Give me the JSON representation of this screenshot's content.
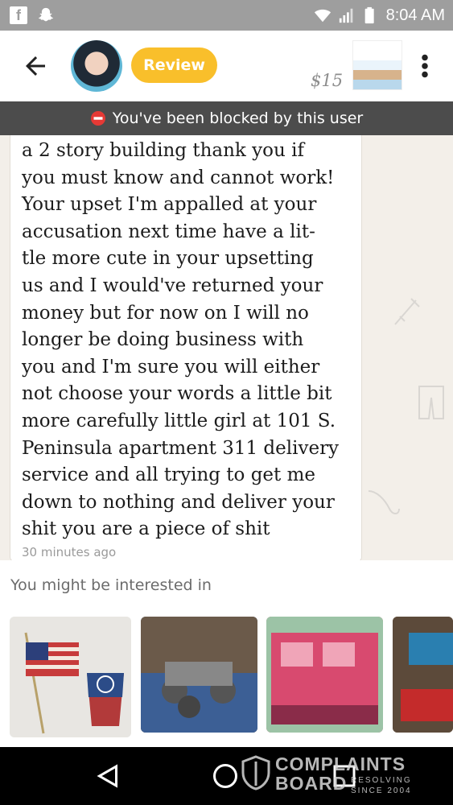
{
  "status_bar": {
    "time": "8:04 AM",
    "icons": [
      "facebook-icon",
      "snapchat-icon",
      "wifi-icon",
      "signal-icon",
      "battery-icon"
    ]
  },
  "header": {
    "review_label": "Review",
    "price": "$15",
    "icons": [
      "back-arrow-icon",
      "more-vert-icon"
    ]
  },
  "banner": {
    "text": "You've been blocked by this user",
    "icon": "blocked-icon"
  },
  "message": {
    "lines": [
      "a 2 story building thank you if",
      "you must know and cannot work!",
      "Your upset I'm appalled at your",
      "accusation next time have a lit-",
      "tle more cute in your upsetting",
      "us and I would've returned your",
      "money but for now on I will no",
      "longer be doing business with",
      "you and I'm sure you will either",
      "not choose your words a little bit",
      "more carefully little girl at 101 S.",
      "Peninsula apartment 311 delivery",
      "service and all trying to get me",
      "down to nothing and deliver your",
      "shit you are a piece of shit"
    ],
    "timestamp": "30 minutes ago"
  },
  "suggestions": {
    "title": "You might be interested in",
    "items": [
      {
        "description": "american-flag-decor"
      },
      {
        "description": "rc-monster-truck"
      },
      {
        "description": "pink-toy-bus"
      },
      {
        "description": "toy-item"
      }
    ]
  },
  "nav": {
    "icons": [
      "nav-back-icon",
      "nav-home-icon",
      "nav-recent-icon"
    ]
  },
  "watermark": {
    "line1": "COMPLAINTS",
    "line2": "BOARD",
    "tag1": "RESOLVING",
    "tag2": "SINCE 2004"
  },
  "colors": {
    "review_button": "#f9bf2b",
    "banner": "#4c4c4c",
    "blocked_icon": "#e53935"
  }
}
